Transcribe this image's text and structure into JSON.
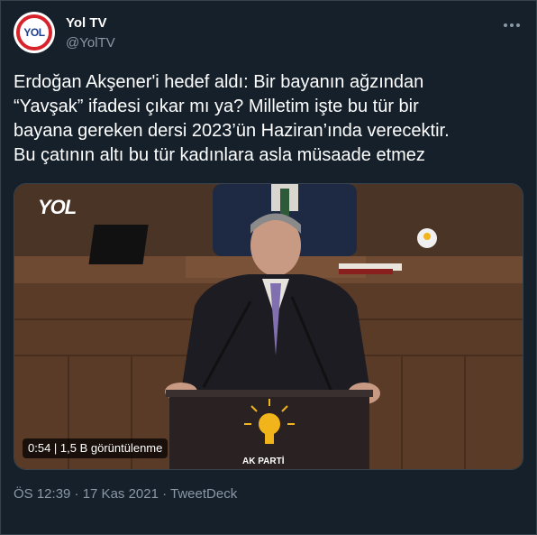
{
  "author": {
    "name": "Yol TV",
    "handle": "@YolTV",
    "avatar_text": "YOL"
  },
  "tweet": {
    "text": "Erdoğan Akşener'i hedef aldı: Bir bayanın ağzından\n“Yavşak” ifadesi çıkar mı ya? Milletim işte bu tür bir\nbayana gereken dersi 2023’ün Haziran’ında verecektir.\nBu çatının altı bu tür kadınlara asla müsaade etmez"
  },
  "video": {
    "badge": "0:54 | 1,5 B görüntülenme",
    "watermark": "YOL",
    "podium_text": "AK PARTİ"
  },
  "meta": {
    "line": "ÖS 12:39 · 17 Kas 2021 · TweetDeck"
  },
  "more_icon": "more-dots-icon"
}
